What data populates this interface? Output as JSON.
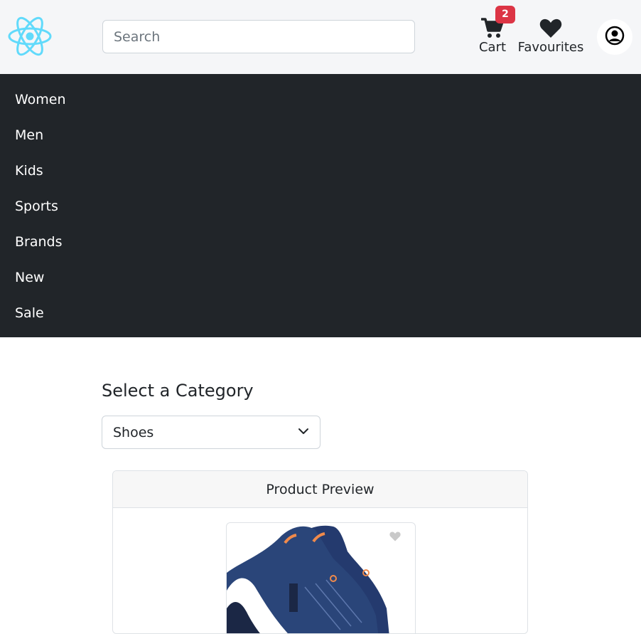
{
  "header": {
    "search_placeholder": "Search",
    "cart_label": "Cart",
    "cart_count": "2",
    "favourites_label": "Favourites"
  },
  "menu": {
    "items": [
      "Women",
      "Men",
      "Kids",
      "Sports",
      "Brands",
      "New",
      "Sale"
    ]
  },
  "main": {
    "category_title": "Select a Category",
    "category_selected": "Shoes",
    "preview_title": "Product Preview"
  },
  "colors": {
    "header_bg": "#f5f6f8",
    "menu_bg": "#212529",
    "badge": "#dc3545",
    "logo": "#61dafb"
  },
  "icons": {
    "logo": "react-logo-icon",
    "cart": "cart-icon",
    "favourites": "heart-icon",
    "profile": "user-circle-icon",
    "select": "chevron-down-icon",
    "favourite_toggle": "heart-icon"
  }
}
